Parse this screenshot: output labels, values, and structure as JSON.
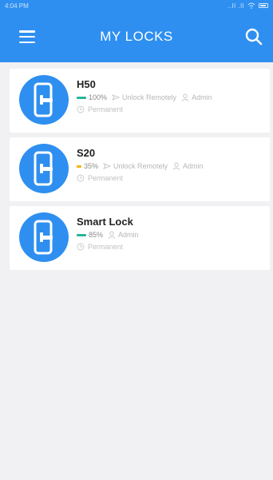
{
  "status_bar": {
    "time": "4:04 PM",
    "signal": "..Il .Il"
  },
  "app_bar": {
    "title": "MY LOCKS"
  },
  "colors": {
    "primary": "#2e8ff0",
    "battery_high": "#28b59a",
    "battery_low": "#f5b400"
  },
  "locks": [
    {
      "name": "H50",
      "battery": "100%",
      "battery_level": 1.0,
      "battery_color": "#28b59a",
      "remote": "Unlock Remotely",
      "role": "Admin",
      "validity": "Permanent",
      "icon": "door-lock-icon"
    },
    {
      "name": "S20",
      "battery": "35%",
      "battery_level": 0.35,
      "battery_color": "#f5b400",
      "remote": "Unlock Remotely",
      "role": "Admin",
      "validity": "Permanent",
      "icon": "door-lock-icon"
    },
    {
      "name": "Smart Lock",
      "battery": "85%",
      "battery_level": 0.85,
      "battery_color": "#28b59a",
      "role": "Admin",
      "validity": "Permanent",
      "icon": "door-lock-icon"
    }
  ]
}
